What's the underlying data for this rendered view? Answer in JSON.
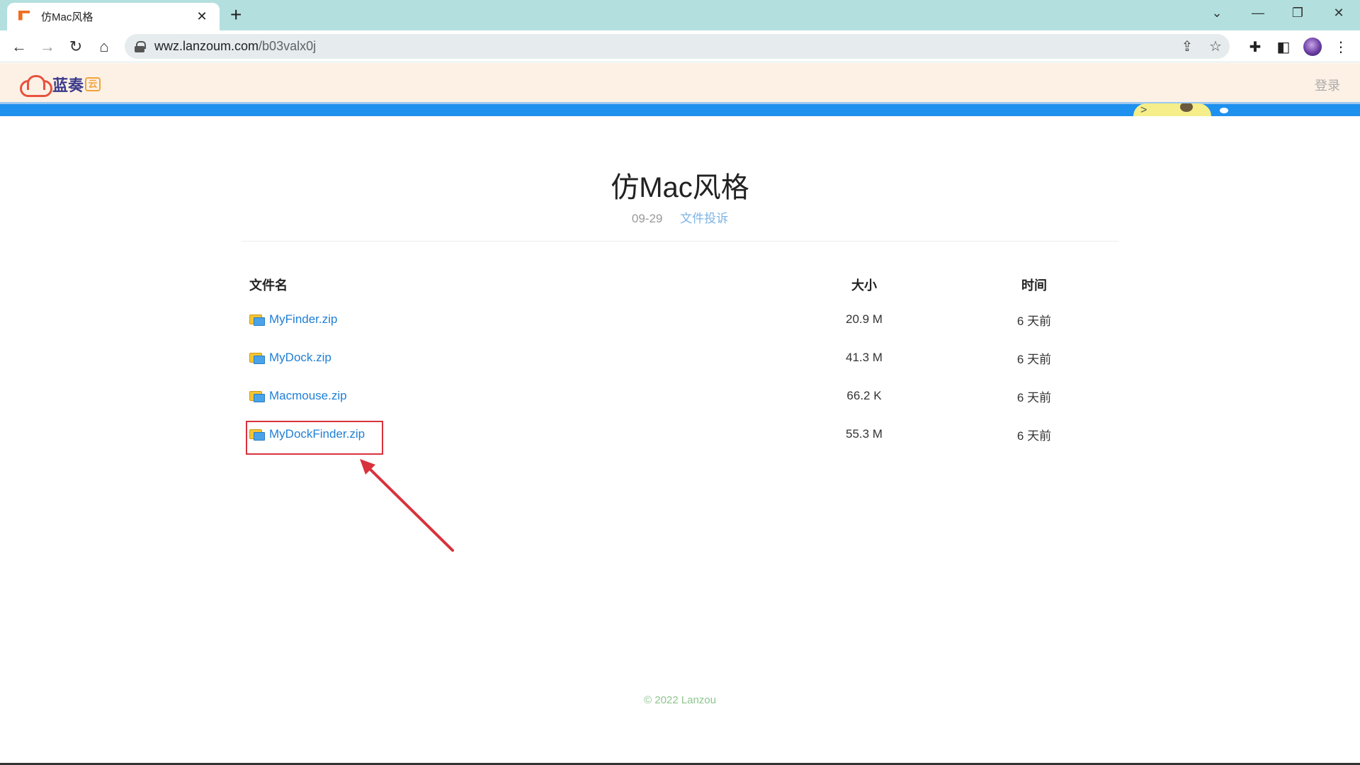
{
  "browser": {
    "tab_title": "仿Mac风格",
    "url_host": "wwz.lanzoum.com",
    "url_path": "/b03valx0j"
  },
  "site": {
    "logo_text": "蓝奏",
    "logo_badge": "云",
    "login_label": "登录"
  },
  "folder": {
    "title": "仿Mac风格",
    "date": "09-29",
    "report_link": "文件投诉"
  },
  "table": {
    "headers": {
      "name": "文件名",
      "size": "大小",
      "time": "时间"
    },
    "rows": [
      {
        "name": "MyFinder.zip",
        "size": "20.9 M",
        "time": "6 天前"
      },
      {
        "name": "MyDock.zip",
        "size": "41.3 M",
        "time": "6 天前"
      },
      {
        "name": "Macmouse.zip",
        "size": "66.2 K",
        "time": "6 天前"
      },
      {
        "name": "MyDockFinder.zip",
        "size": "55.3 M",
        "time": "6 天前"
      }
    ]
  },
  "footer": {
    "copyright": "© 2022 Lanzou"
  },
  "colors": {
    "accent_blue": "#1e90ee",
    "link": "#1f7fd6",
    "highlight": "#d8323c",
    "header_bg": "#fdf1e6"
  }
}
